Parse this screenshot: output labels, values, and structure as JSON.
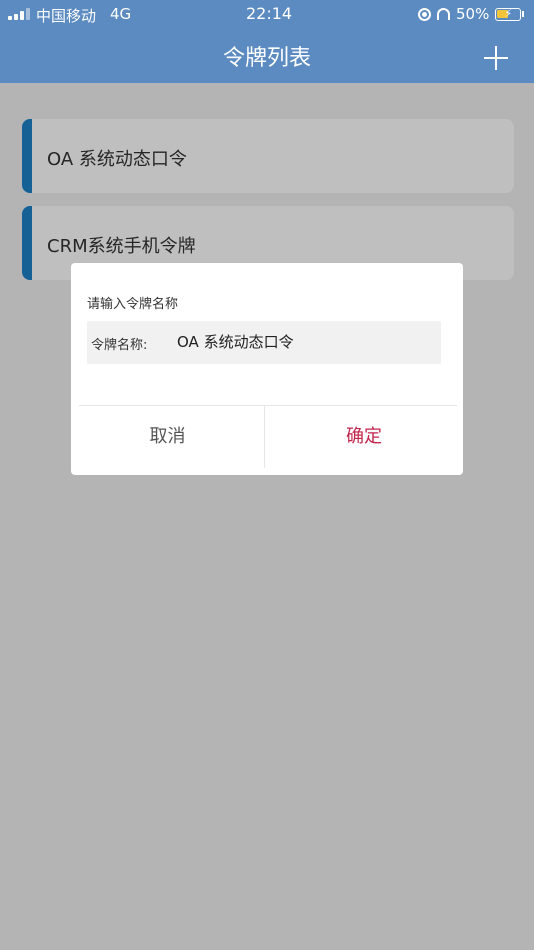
{
  "status_bar": {
    "carrier": "中国移动",
    "network": "4G",
    "time": "22:14",
    "battery": "50%",
    "battery_level": 0.5,
    "battery_fill_color": "#f3c43a"
  },
  "header": {
    "title": "令牌列表",
    "add_icon": "plus-icon",
    "background": "#5b8bc0"
  },
  "token_list": [
    {
      "label": "OA 系统动态口令"
    },
    {
      "label": "CRM系统手机令牌"
    }
  ],
  "accent_color": "#1c82c9",
  "dialog": {
    "prompt": "请输入令牌名称",
    "field_label": "令牌名称:",
    "field_value": "OA 系统动态口令",
    "cancel_label": "取消",
    "confirm_label": "确定",
    "confirm_color": "#c2254c"
  }
}
